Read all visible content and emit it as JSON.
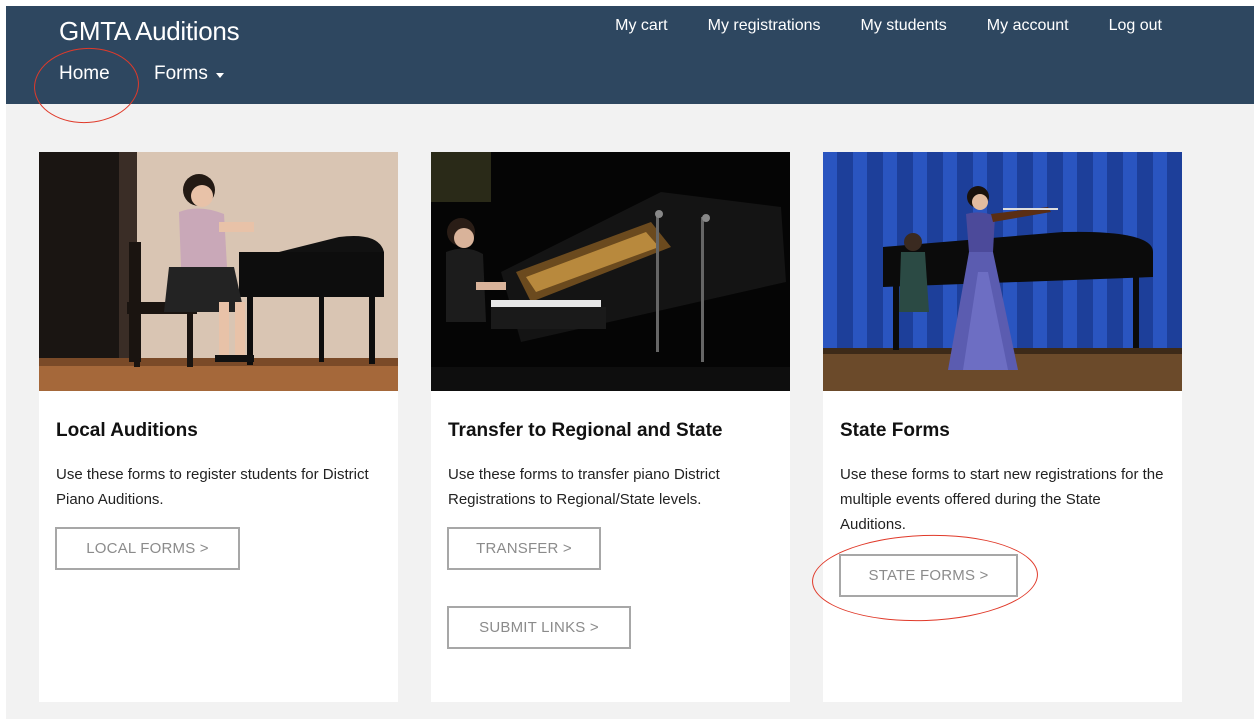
{
  "header": {
    "brand": "GMTA Auditions",
    "home_label": "Home",
    "forms_label": "Forms",
    "links": [
      "My cart",
      "My registrations",
      "My students",
      "My account",
      "Log out"
    ]
  },
  "cards": [
    {
      "title": "Local Auditions",
      "text": "Use these forms to register students for District Piano Auditions.",
      "buttons": [
        "LOCAL FORMS >"
      ]
    },
    {
      "title": "Transfer to Regional and State",
      "text": "Use these forms to transfer piano District Registrations to Regional/State levels.",
      "buttons": [
        "TRANSFER >",
        "SUBMIT LINKS >"
      ]
    },
    {
      "title": "State Forms",
      "text": "Use these forms to start new registrations for the multiple events offered during the State Auditions.",
      "buttons": [
        "STATE FORMS >"
      ]
    }
  ],
  "colors": {
    "navbar": "#2e4760",
    "page_background": "#f2f2f2",
    "annotation": "#e03a2a",
    "button_border": "#a7a7a7",
    "button_text": "#8b8b8b"
  }
}
